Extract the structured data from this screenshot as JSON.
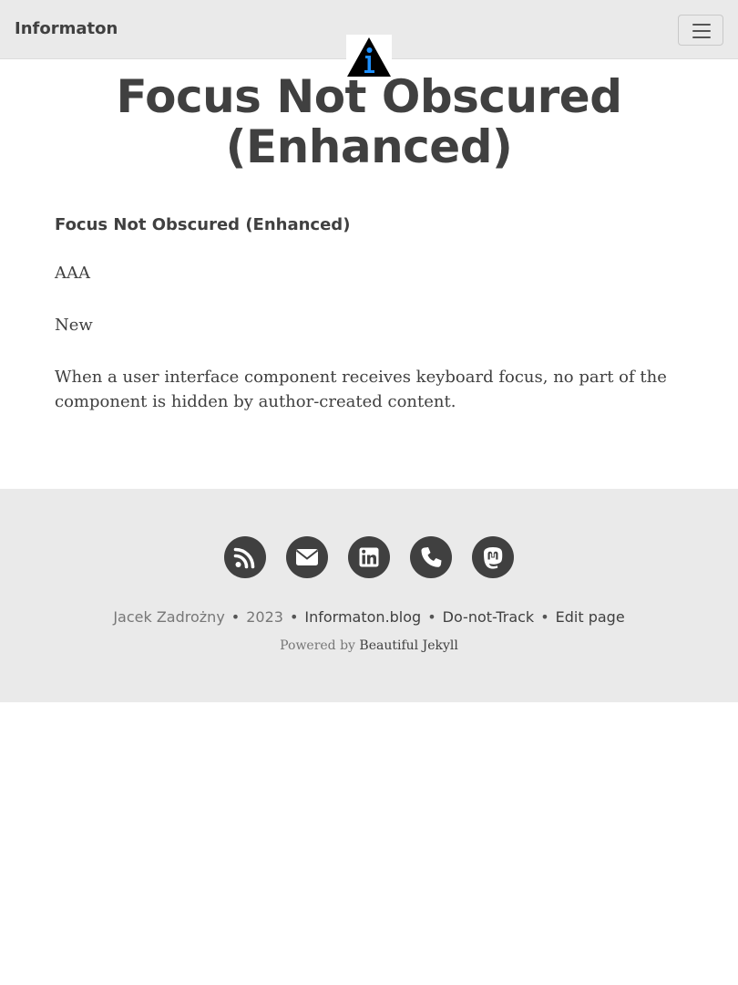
{
  "navbar": {
    "brand": "Informaton",
    "menu_icon": "hamburger-menu-icon",
    "avatar_icon": "informaton-logo-icon",
    "logo_colors": {
      "triangle": "#000000",
      "letter": "#1e90ff"
    }
  },
  "page": {
    "title": "Focus Not Obscured (Enhanced)"
  },
  "content": {
    "term": "Focus Not Obscured (Enhanced)",
    "level": "AAA",
    "status": "New",
    "description": "When a user interface component receives keyboard focus, no part of the component is hidden by author-created content."
  },
  "footer": {
    "social_icons": [
      "rss-icon",
      "envelope-icon",
      "linkedin-icon",
      "phone-icon",
      "mastodon-icon"
    ],
    "author": "Jacek Zadrożny",
    "year": "2023",
    "blog_link": "Informaton.blog",
    "dnt_link": "Do-not-Track",
    "edit_link": "Edit page",
    "separator": "•",
    "powered_prefix": "Powered by",
    "powered_link": "Beautiful Jekyll"
  },
  "colors": {
    "navbar_bg": "#eaeaea",
    "text": "#404040",
    "muted": "#777777",
    "icon_circle": "#404040",
    "page_bg": "#ffffff"
  }
}
